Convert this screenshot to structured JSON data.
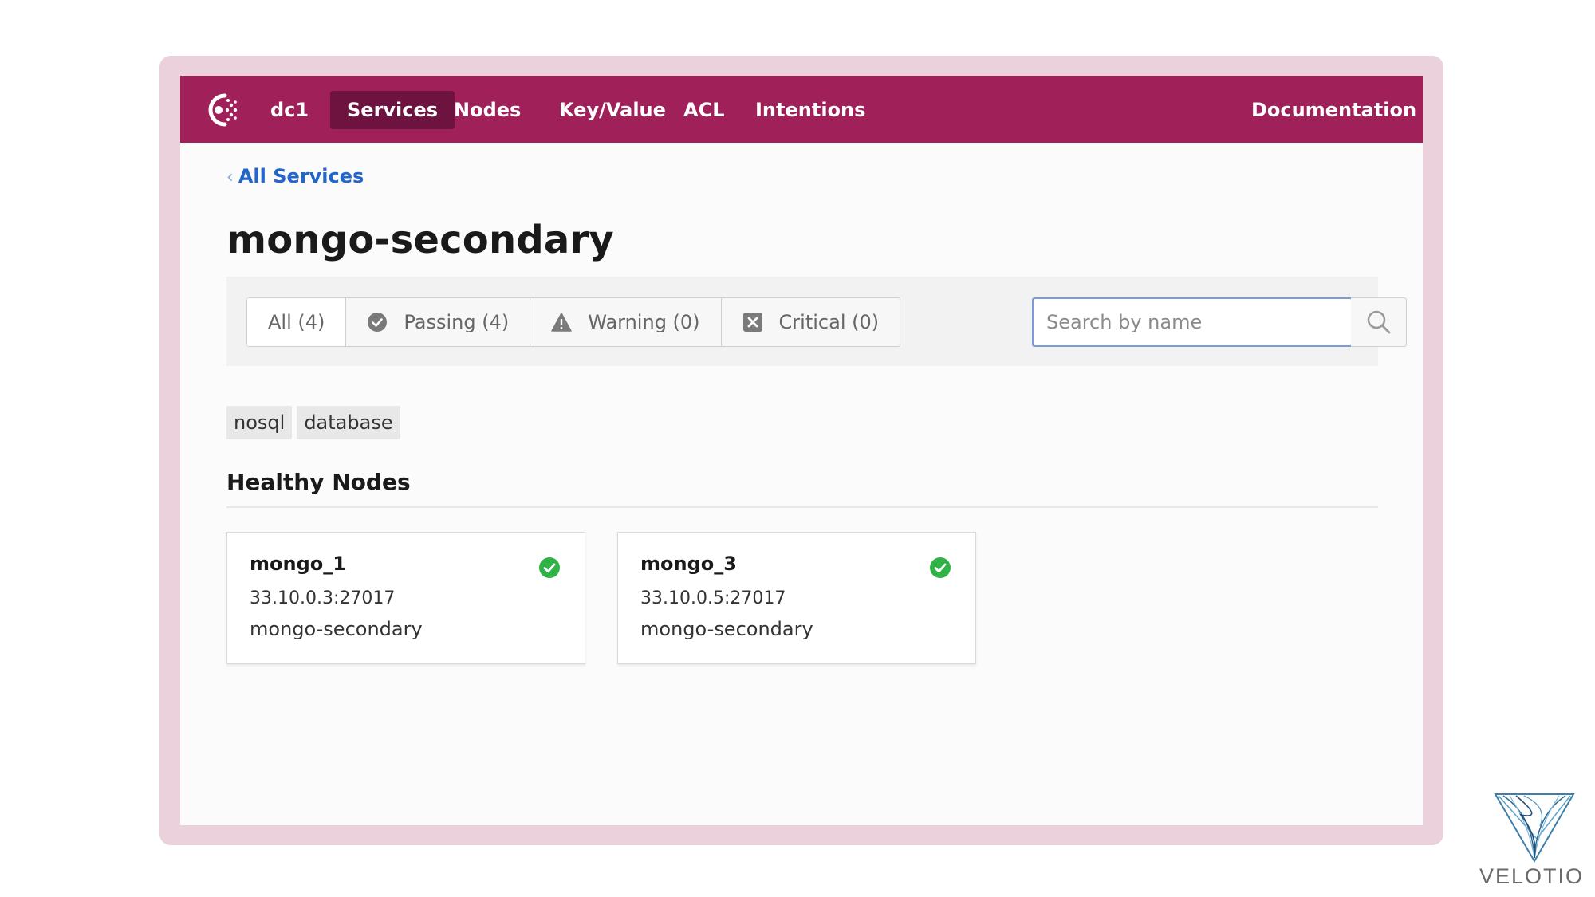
{
  "nav": {
    "datacenter": "dc1",
    "items": [
      {
        "label": "Services"
      },
      {
        "label": "Nodes"
      },
      {
        "label": "Key/Value"
      },
      {
        "label": "ACL"
      },
      {
        "label": "Intentions"
      }
    ],
    "active": "Services",
    "documentation": "Documentation",
    "logo_icon": "consul-logo-icon",
    "bg_color": "#a0215a",
    "active_color": "#6e1340"
  },
  "breadcrumb": {
    "chevron": "‹",
    "label": "All Services"
  },
  "page": {
    "title": "mongo-secondary"
  },
  "filters": {
    "segments": [
      {
        "label": "All (4)",
        "icon": null
      },
      {
        "label": "Passing (4)",
        "icon": "check-circle-icon"
      },
      {
        "label": "Warning (0)",
        "icon": "warning-triangle-icon"
      },
      {
        "label": "Critical (0)",
        "icon": "critical-x-square-icon"
      }
    ],
    "selected": "All (4)",
    "search": {
      "placeholder": "Search by name",
      "value": ""
    }
  },
  "tags": [
    "nosql",
    "database"
  ],
  "healthy_nodes": {
    "heading": "Healthy Nodes",
    "cards": [
      {
        "name": "mongo_1",
        "address": "33.10.0.3:27017",
        "service": "mongo-secondary",
        "status": "passing"
      },
      {
        "name": "mongo_3",
        "address": "33.10.0.5:27017",
        "service": "mongo-secondary",
        "status": "passing"
      }
    ],
    "status_color": "#2fb347"
  },
  "watermark": {
    "text": "VELOTIO"
  }
}
